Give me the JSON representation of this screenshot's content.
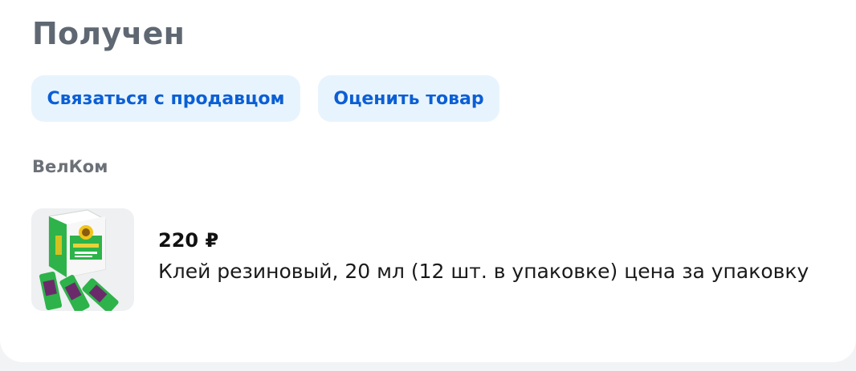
{
  "order": {
    "status": "Получен"
  },
  "actions": {
    "contact_seller_label": "Связаться с продавцом",
    "rate_product_label": "Оценить товар"
  },
  "seller": {
    "name": "ВелКом"
  },
  "product": {
    "price": "220 ₽",
    "name": "Клей резиновый, 20 мл (12 шт. в упаковке) цена за упаковку",
    "image_icon": "glue-tubes-box-image"
  },
  "colors": {
    "accent": "#0b5fd6",
    "button_bg": "#e8f4fd",
    "status_text": "#5f6872",
    "package_green": "#2db34a"
  }
}
